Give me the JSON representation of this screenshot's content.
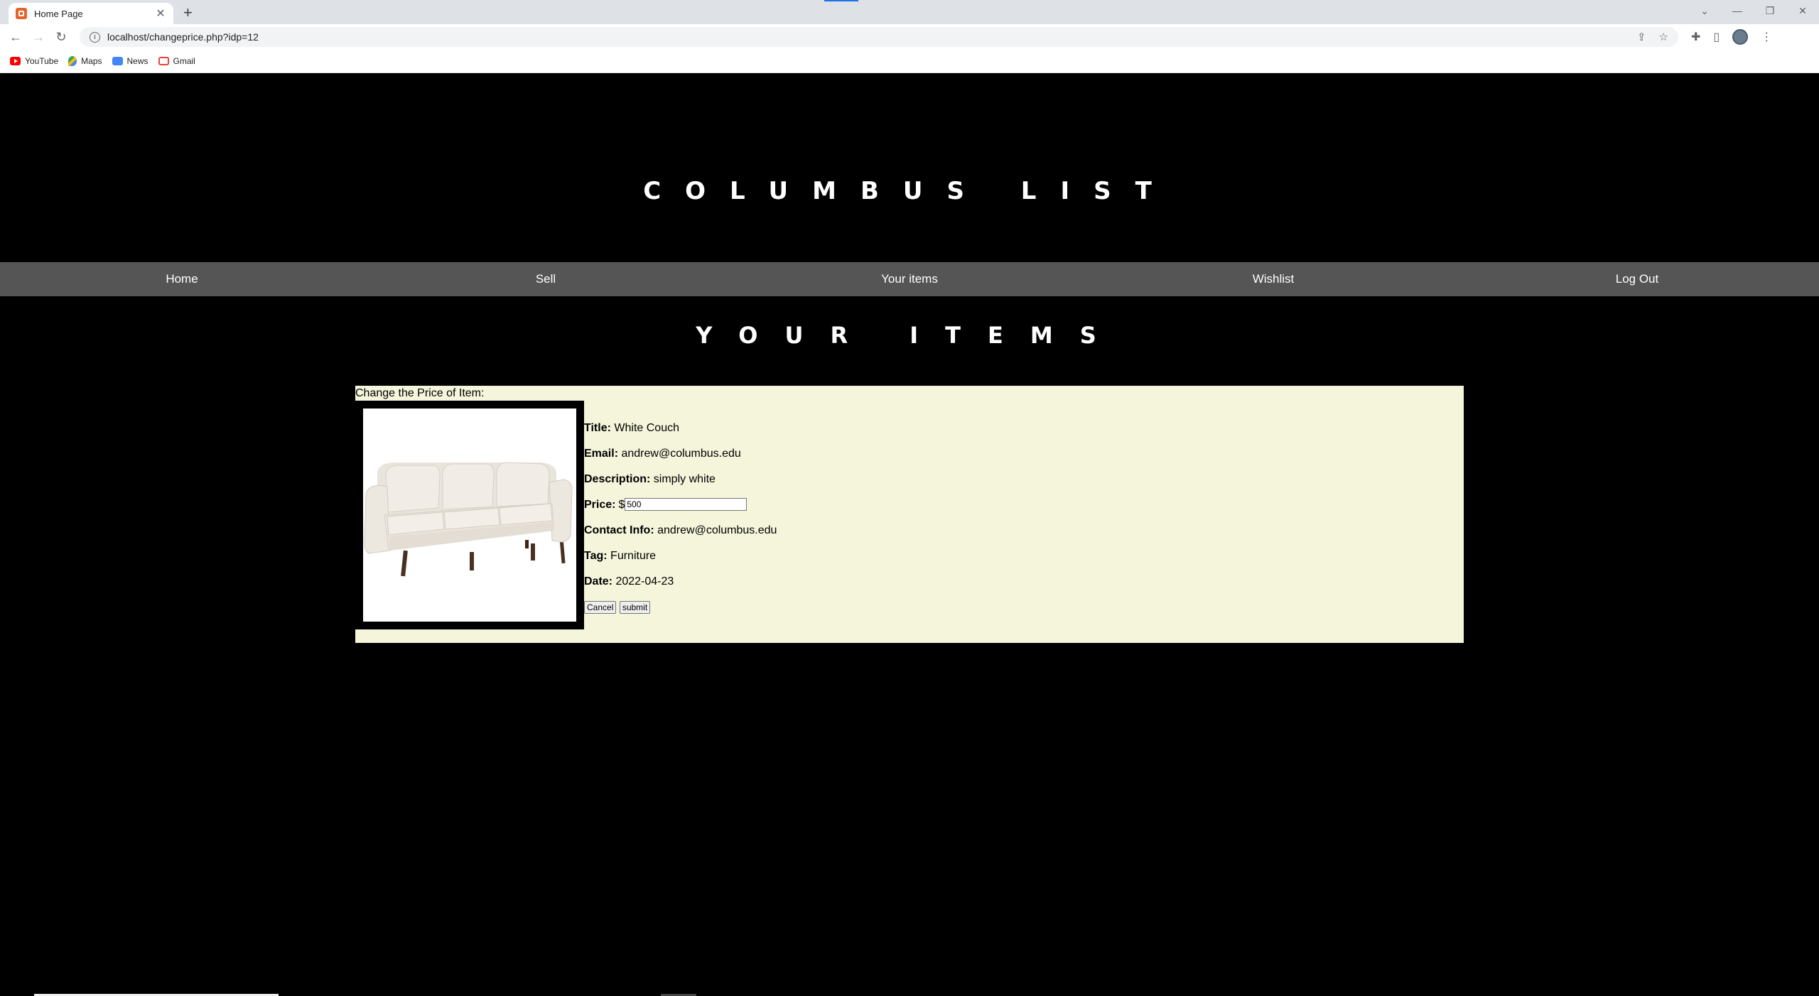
{
  "browser": {
    "tab_title": "Home Page",
    "tab_close": "✕",
    "new_tab": "+",
    "url": "localhost/changeprice.php?idp=12",
    "bookmarks": [
      "YouTube",
      "Maps",
      "News",
      "Gmail"
    ]
  },
  "site": {
    "title": "COLUMBUS LIST",
    "nav": [
      "Home",
      "Sell",
      "Your items",
      "Wishlist",
      "Log Out"
    ],
    "section_title": "YOUR ITEMS"
  },
  "item": {
    "caption": "Change the Price of Item:",
    "image_alt": "white-couch",
    "title_label": "Title:",
    "title_value": "White Couch",
    "email_label": "Email:",
    "email_value": "andrew@columbus.edu",
    "description_label": "Description:",
    "description_value": "simply white",
    "price_label": "Price:",
    "price_prefix": "$",
    "price_value": "500",
    "contact_label": "Contact Info:",
    "contact_value": "andrew@columbus.edu",
    "tag_label": "Tag:",
    "tag_value": "Furniture",
    "date_label": "Date:",
    "date_value": "2022-04-23",
    "cancel_label": "Cancel",
    "submit_label": "submit"
  },
  "colors": {
    "page_bg": "#000000",
    "navbar_bg": "#555555",
    "panel_bg": "#f5f5dc"
  }
}
